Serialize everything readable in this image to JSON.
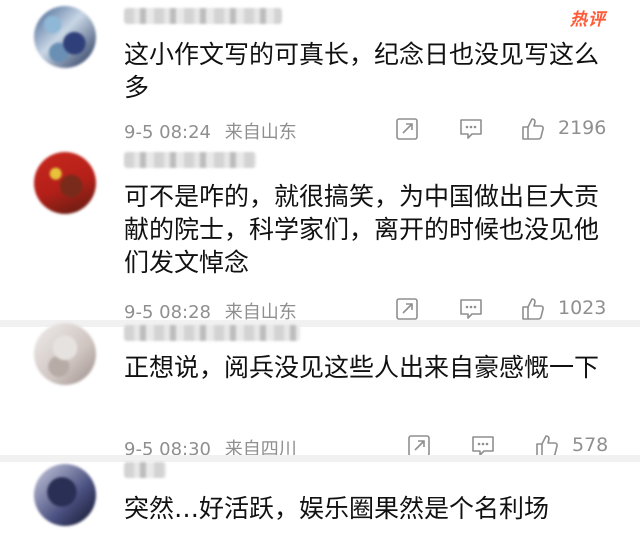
{
  "badge": {
    "hot": "热评"
  },
  "comments": [
    {
      "text": "这小作文写的可真长，纪念日也没见写这么多",
      "date": "9-5 08:24",
      "location": "来自山东",
      "likes": "2196"
    },
    {
      "text": "可不是咋的，就很搞笑，为中国做出巨大贡献的院士，科学家们，离开的时候也没见他们发文悼念",
      "date": "9-5 08:28",
      "location": "来自山东",
      "likes": "1023"
    },
    {
      "text": "正想说，阅兵没见这些人出来自豪感慨一下",
      "date": "9-5 08:30",
      "location": "来自四川",
      "likes": "578"
    },
    {
      "text": "突然…好活跃，娱乐圈果然是个名利场",
      "date": "",
      "location": "",
      "likes": ""
    }
  ],
  "colors": {
    "text": "#111111",
    "meta": "#8f8f8f",
    "hot": "#ff5b37",
    "separator": "#f1f1f1"
  },
  "icons": [
    "share-icon",
    "comment-icon",
    "like-icon"
  ]
}
